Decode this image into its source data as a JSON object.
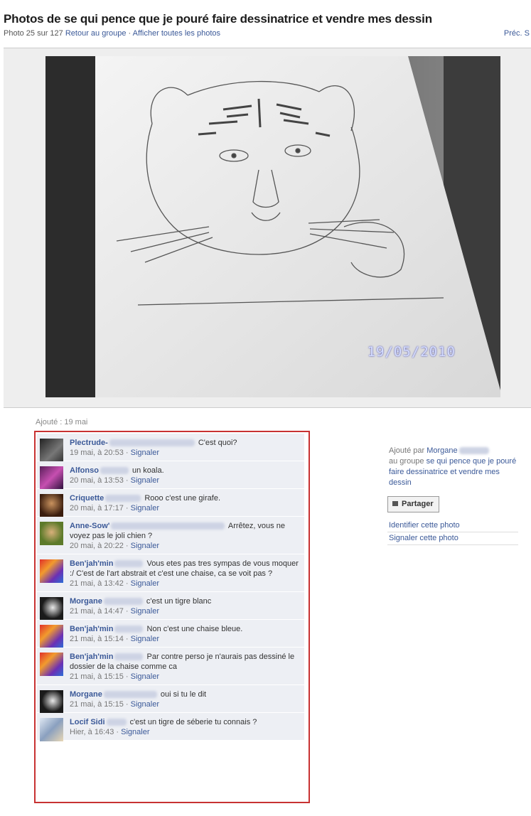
{
  "header": {
    "title": "Photos de se qui pence que je pouré faire dessinatrice et vendre mes dessin",
    "counter": "Photo 25 sur 127",
    "back_link": "Retour au groupe",
    "separator": "·",
    "all_photos_link": "Afficher toutes les photos",
    "prev_link": "Préc.",
    "next_link": "S"
  },
  "photo": {
    "date_stamp": "19/05/2010"
  },
  "added_label": "Ajouté : 19 mai",
  "comments": [
    {
      "name": "Plectrude-",
      "text": "C'est quoi?",
      "time": "19 mai, à 20:53",
      "report": "Signaler",
      "avatar": "photo-avatar-dark"
    },
    {
      "name": "Alfonso",
      "text": "un koala.",
      "time": "20 mai, à 13:53",
      "report": "Signaler",
      "avatar": "photo-avatar-purple"
    },
    {
      "name": "Criquette",
      "text": "Rooo c'est une girafe.",
      "time": "20 mai, à 17:17",
      "report": "Signaler",
      "avatar": "photo-avatar-brown"
    },
    {
      "name": "Anne-Sow'",
      "text": "Arrêtez, vous ne voyez pas le joli chien ?",
      "time": "20 mai, à 20:22",
      "report": "Signaler",
      "avatar": "photo-avatar-green"
    },
    {
      "name": "Ben'jah'min",
      "text": "Vous etes pas tres sympas de vous moquer :/ C'est de l'art abstrait et c'est une chaise, ca se voit pas ?",
      "time": "21 mai, à 13:42",
      "report": "Signaler",
      "avatar": "photo-avatar-colorful"
    },
    {
      "name": "Morgane",
      "text": "c'est un tigre blanc",
      "time": "21 mai, à 14:47",
      "report": "Signaler",
      "avatar": "photo-avatar-bw"
    },
    {
      "name": "Ben'jah'min",
      "text": "Non c'est une chaise bleue.",
      "time": "21 mai, à 15:14",
      "report": "Signaler",
      "avatar": "photo-avatar-colorful"
    },
    {
      "name": "Ben'jah'min",
      "text": "Par contre perso je n'aurais pas dessiné le dossier de la chaise comme ca",
      "time": "21 mai, à 15:15",
      "report": "Signaler",
      "avatar": "photo-avatar-colorful"
    },
    {
      "name": "Morgane",
      "text": "oui si tu le dit",
      "time": "21 mai, à 15:15",
      "report": "Signaler",
      "avatar": "photo-avatar-bw"
    },
    {
      "name": "Locif Sidi",
      "text": "c'est un tigre de séberie tu connais ?",
      "time": "Hier, à 16:43",
      "report": "Signaler",
      "avatar": "photo-avatar-light"
    }
  ],
  "sidebar": {
    "added_by_label": "Ajouté par",
    "added_by_name": "Morgane",
    "group_prefix": "au groupe",
    "group_name": "se qui pence que je pouré faire dessinatrice et vendre mes dessin",
    "share_button": "Partager",
    "tag_link": "Identifier cette photo",
    "report_link": "Signaler cette photo"
  },
  "colors": {
    "link": "#3b5998",
    "comment_bg": "#edeff4",
    "highlight_border": "#c83232"
  }
}
